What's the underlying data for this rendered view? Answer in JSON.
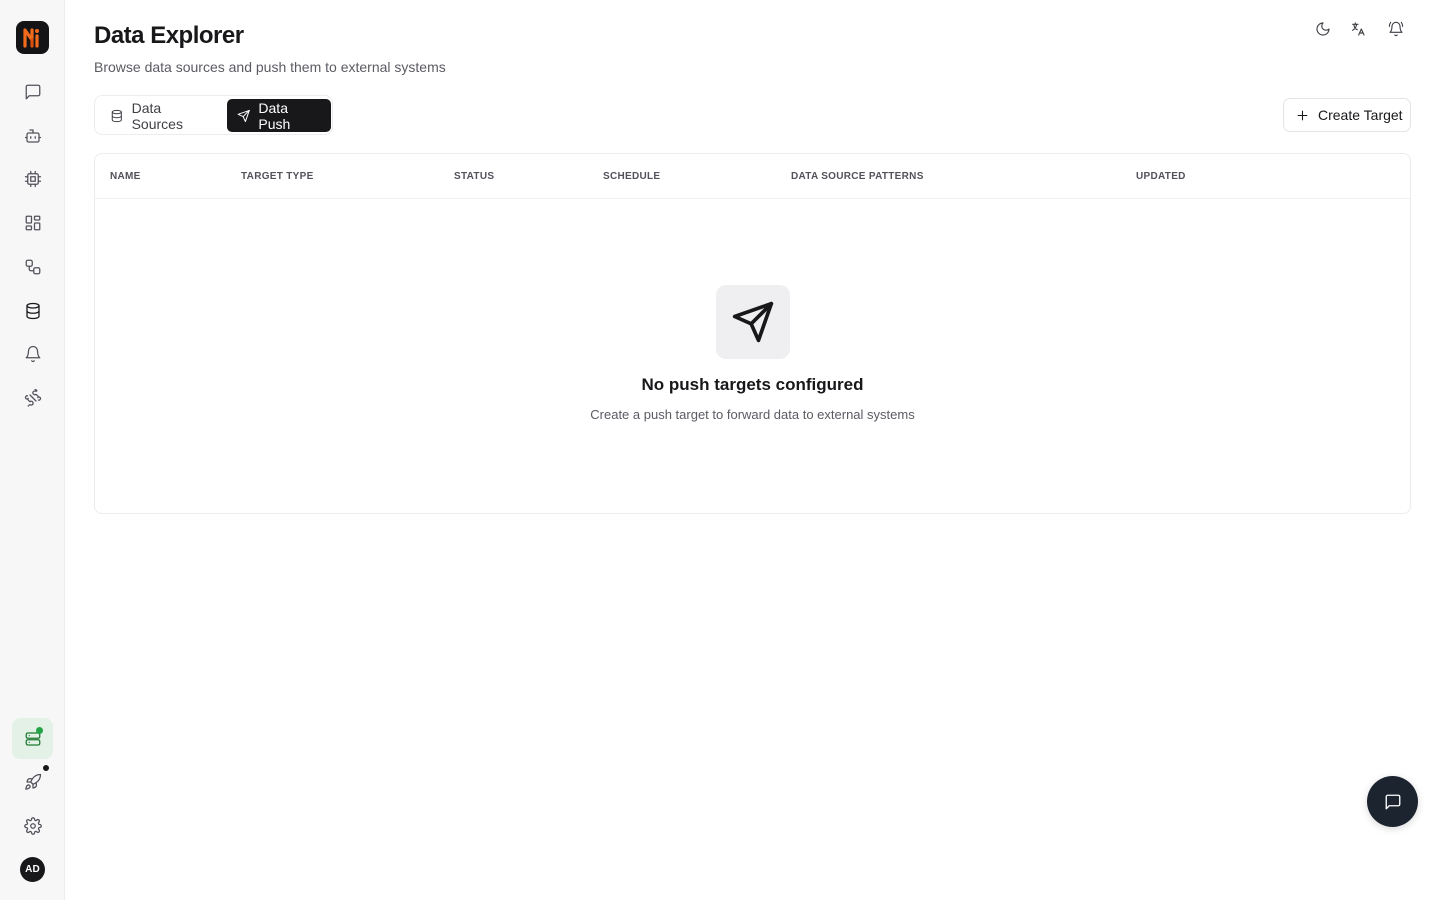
{
  "app": {
    "logo_icon": "brand-logo-icon",
    "brand_colors": {
      "logo_bg": "#141416",
      "logo_orange": "#f26b1d"
    }
  },
  "sidebar": {
    "items": [
      {
        "id": "chat",
        "icon": "message-square-icon",
        "active": false
      },
      {
        "id": "agents",
        "icon": "bot-icon",
        "active": false
      },
      {
        "id": "models",
        "icon": "cpu-icon",
        "active": false
      },
      {
        "id": "dashboard",
        "icon": "layout-grid-icon",
        "active": false
      },
      {
        "id": "workflows",
        "icon": "workflow-icon",
        "active": false
      },
      {
        "id": "data",
        "icon": "database-icon",
        "active": true
      },
      {
        "id": "alerts",
        "icon": "bell-icon",
        "active": false
      },
      {
        "id": "plugins",
        "icon": "puzzle-icon",
        "active": false
      }
    ],
    "bottom": [
      {
        "id": "status",
        "icon": "server-status-icon",
        "highlight_color": "#e4f1e6",
        "dot_color": "#22a447"
      },
      {
        "id": "launch",
        "icon": "rocket-icon",
        "dot_color": "#18181b"
      },
      {
        "id": "settings",
        "icon": "settings-icon"
      }
    ],
    "avatar": {
      "initials": "AD"
    }
  },
  "header": {
    "title": "Data Explorer",
    "subtitle": "Browse data sources and push them to external systems",
    "icons": [
      "moon-icon",
      "translate-icon",
      "bell-ring-icon"
    ]
  },
  "tabs": [
    {
      "label": "Data Sources",
      "icon": "database-icon",
      "selected": false
    },
    {
      "label": "Data Push",
      "icon": "send-icon",
      "selected": true
    }
  ],
  "actions": {
    "create_label": "Create Target",
    "create_icon": "plus-icon"
  },
  "table": {
    "columns": [
      "NAME",
      "TARGET TYPE",
      "STATUS",
      "SCHEDULE",
      "DATA SOURCE PATTERNS",
      "UPDATED"
    ],
    "rows": [],
    "empty": {
      "icon": "send-icon",
      "title": "No push targets configured",
      "description": "Create a push target to forward data to external systems"
    }
  },
  "chat_fab": {
    "icon": "message-square-icon",
    "color": "#1c2430"
  }
}
